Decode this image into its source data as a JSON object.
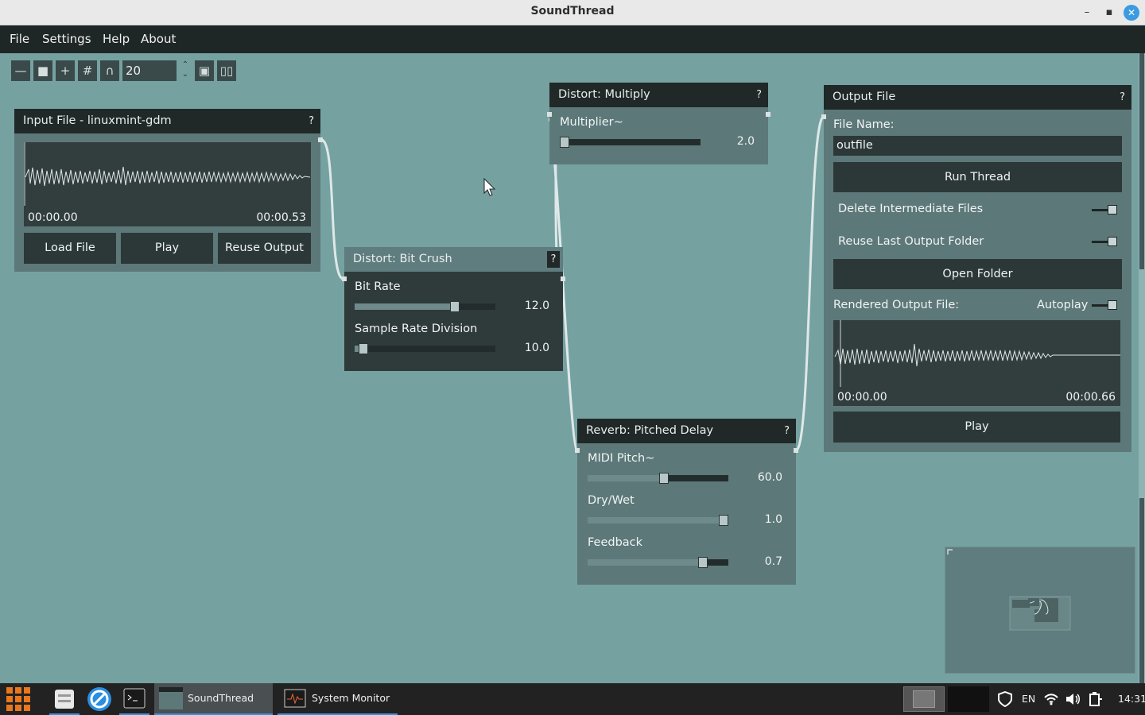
{
  "window": {
    "title": "SoundThread"
  },
  "menu": [
    "File",
    "Settings",
    "Help",
    "About"
  ],
  "toolbar": {
    "snap_value": "20"
  },
  "input_node": {
    "title": "Input File - linuxmint-gdm",
    "help": "?",
    "time_start": "00:00.00",
    "time_end": "00:00.53",
    "buttons": [
      "Load File",
      "Play",
      "Reuse Output"
    ]
  },
  "bitcrush_node": {
    "title": "Distort: Bit Crush",
    "help": "?",
    "params": [
      {
        "label": "Bit Rate",
        "value": "12.0",
        "fraction": 0.71
      },
      {
        "label": "Sample Rate Division",
        "value": "10.0",
        "fraction": 0.06
      }
    ]
  },
  "multiply_node": {
    "title": "Distort: Multiply",
    "help": "?",
    "params": [
      {
        "label": "Multiplier~",
        "value": "2.0",
        "fraction": 0.0
      }
    ]
  },
  "reverb_node": {
    "title": "Reverb: Pitched Delay",
    "help": "?",
    "params": [
      {
        "label": "MIDI Pitch~",
        "value": "60.0",
        "fraction": 0.54
      },
      {
        "label": "Dry/Wet",
        "value": "1.0",
        "fraction": 1.0
      },
      {
        "label": "Feedback",
        "value": "0.7",
        "fraction": 0.82
      }
    ]
  },
  "output_node": {
    "title": "Output File",
    "help": "?",
    "file_name_label": "File Name:",
    "file_name_value": "outfile",
    "run_button": "Run Thread",
    "delete_intermediate_label": "Delete Intermediate Files",
    "reuse_folder_label": "Reuse Last Output Folder",
    "open_folder_button": "Open Folder",
    "rendered_label": "Rendered Output File:",
    "autoplay_label": "Autoplay",
    "time_start": "00:00.00",
    "time_end": "00:00.66",
    "play_button": "Play"
  },
  "taskbar": {
    "apps": [
      "SoundThread",
      "System Monitor"
    ],
    "language": "EN",
    "clock": "14:31"
  },
  "colors": {
    "canvas": "#76a1a1",
    "node_body": "#5d7879",
    "node_header": "#202828",
    "button": "#2c3838"
  }
}
